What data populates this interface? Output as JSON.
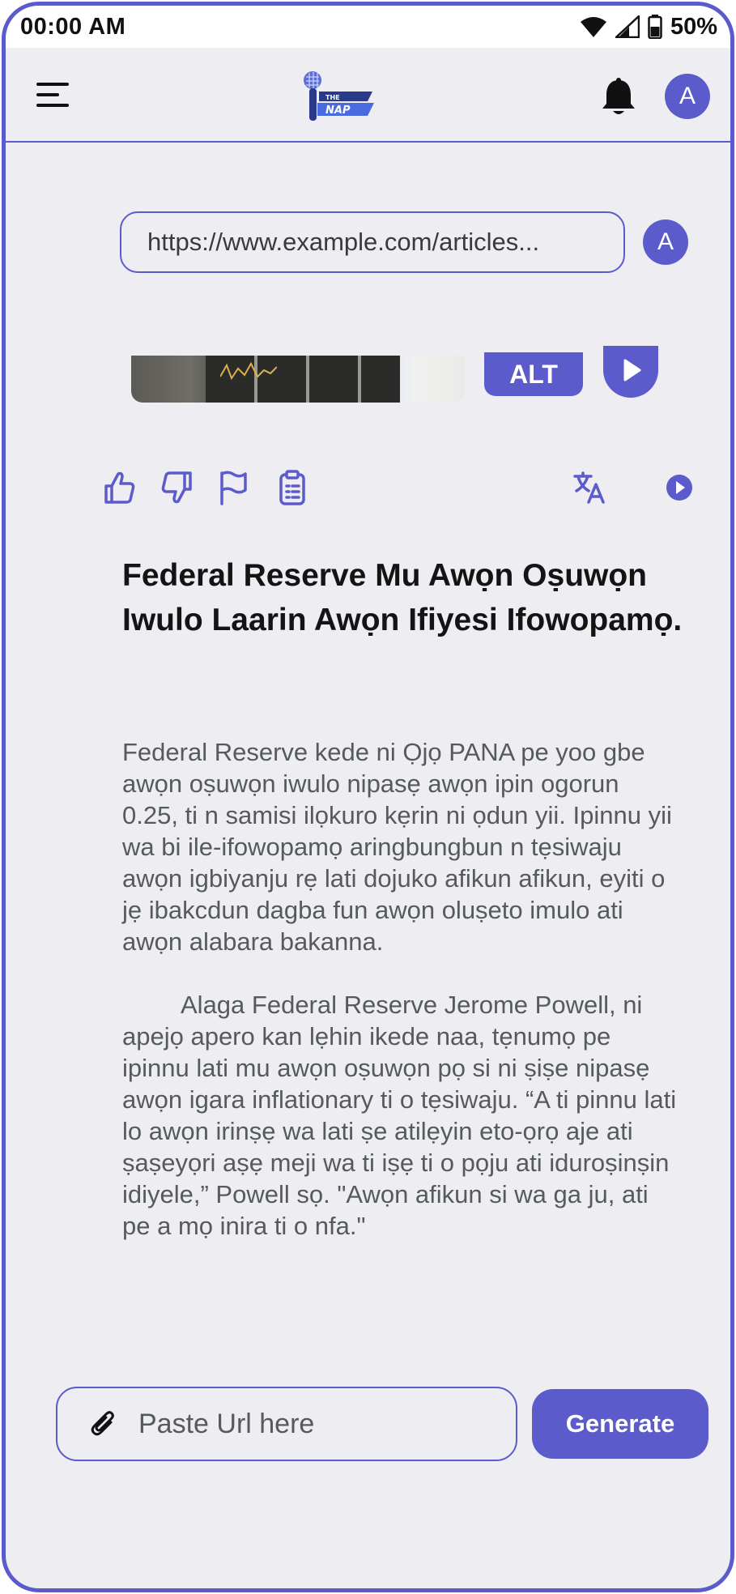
{
  "status_bar": {
    "time": "00:00 AM",
    "battery": "50%",
    "icons": [
      "wifi-icon",
      "signal-icon",
      "battery-icon"
    ]
  },
  "header": {
    "menu_icon": "hamburger-menu-icon",
    "logo_text_top": "THE",
    "logo_text_bottom": "NAP",
    "notification_icon": "bell-icon",
    "avatar_initial": "A"
  },
  "chat": {
    "url": "https://www.example.com/articles...",
    "avatar_initial": "A"
  },
  "media": {
    "alt_label": "ALT",
    "play_icon": "play-icon"
  },
  "actions": {
    "icons": [
      "thumbs-up-icon",
      "thumbs-down-icon",
      "flag-icon",
      "clipboard-icon",
      "translate-icon",
      "play-icon"
    ]
  },
  "article": {
    "title": "Federal Reserve Mu Awọn Oṣuwọn Iwulo Laarin Awọn Ifiyesi Ifowopamọ.",
    "paragraph1": "Federal Reserve kede ni Ọjọ PANA pe yoo gbe awọn oṣuwọn iwulo nipasẹ awọn ipin ogorun 0.25, ti n samisi ilọkuro kẹrin ni ọdun yii. Ipinnu yii wa bi ile-ifowopamọ aringbungbun n tẹsiwaju awọn igbiyanju rẹ lati dojuko afikun afikun, eyiti o jẹ ibakcdun dagba fun awọn oluṣeto imulo ati awọn alabara bakanna.",
    "paragraph2": "Alaga Federal Reserve Jerome Powell, ni apejọ apero kan lẹhin ikede naa, tẹnumọ pe ipinnu lati mu awọn oṣuwọn pọ si ni ṣiṣe nipasẹ awọn igara inflationary ti o tẹsiwaju. “A ti pinnu lati lo awọn irinṣẹ wa lati ṣe atilẹyin eto-ọrọ aje ati ṣaṣeyọri aṣẹ meji wa ti iṣẹ ti o pọju ati iduroṣinṣin idiyele,” Powell sọ. \"Awọn afikun si wa ga ju, ati pe a mọ inira ti o nfa.\""
  },
  "composer": {
    "attach_icon": "paperclip-icon",
    "placeholder": "Paste Url here",
    "value": "",
    "generate_label": "Generate"
  },
  "colors": {
    "accent": "#5b5bcc",
    "background": "#eeeef2",
    "body_text": "#555a5d",
    "title_text": "#141414"
  }
}
